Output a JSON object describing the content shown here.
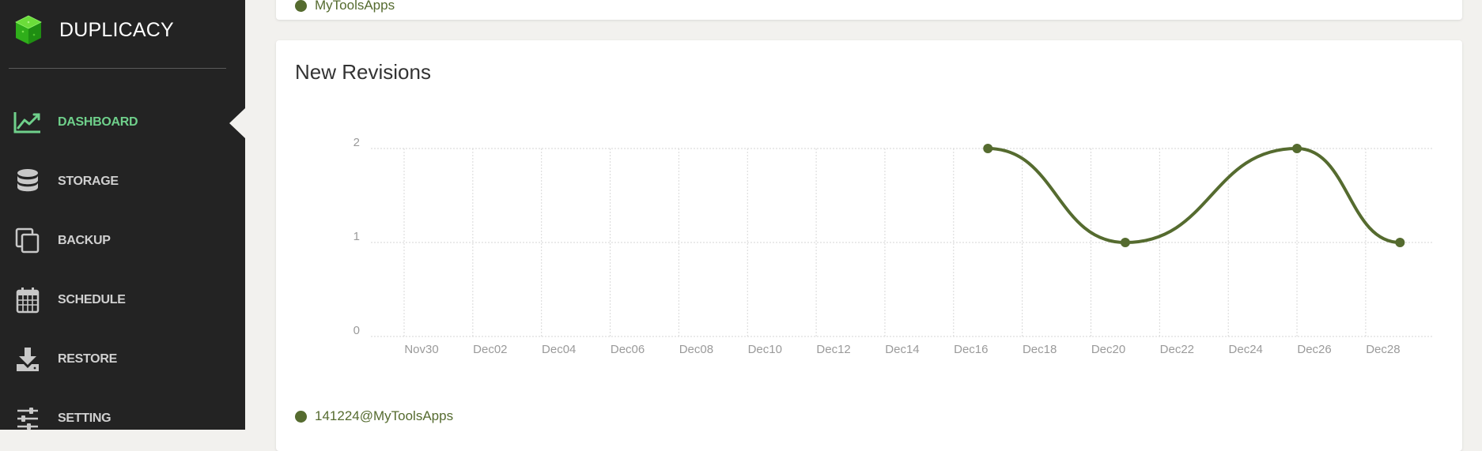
{
  "app": {
    "name": "DUPLICACY"
  },
  "sidebar": {
    "items": [
      {
        "label": "DASHBOARD",
        "icon": "line-chart-icon",
        "active": true
      },
      {
        "label": "STORAGE",
        "icon": "database-icon",
        "active": false
      },
      {
        "label": "BACKUP",
        "icon": "copy-icon",
        "active": false
      },
      {
        "label": "SCHEDULE",
        "icon": "calendar-icon",
        "active": false
      },
      {
        "label": "RESTORE",
        "icon": "download-icon",
        "active": false
      },
      {
        "label": "SETTING",
        "icon": "sliders-icon",
        "active": false
      }
    ]
  },
  "top_card": {
    "legend_label": "MyToolsApps"
  },
  "revisions_card": {
    "title": "New Revisions",
    "legend_label": "141224@MyToolsApps"
  },
  "colors": {
    "sidebar_bg": "#232323",
    "active_text": "#6fd08b",
    "series": "#556b2f",
    "page_bg": "#f2f1ee"
  },
  "chart_data": {
    "type": "line",
    "title": "New Revisions",
    "x_tick_labels": [
      "Nov30",
      "Dec02",
      "Dec04",
      "Dec06",
      "Dec08",
      "Dec10",
      "Dec12",
      "Dec14",
      "Dec16",
      "Dec18",
      "Dec20",
      "Dec22",
      "Dec24",
      "Dec26",
      "Dec28"
    ],
    "y_tick_labels": [
      "0",
      "1",
      "2"
    ],
    "ylim": [
      0,
      2
    ],
    "grid": true,
    "legend_position": "bottom-left",
    "series": [
      {
        "name": "141224@MyToolsApps",
        "color": "#556b2f",
        "x": [
          "Dec17",
          "Dec21",
          "Dec26",
          "Dec29"
        ],
        "values": [
          2,
          1,
          2,
          1
        ]
      }
    ]
  }
}
